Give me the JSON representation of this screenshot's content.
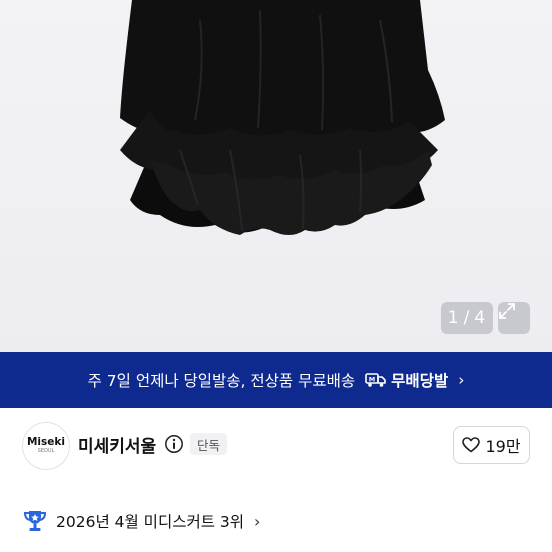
{
  "gallery": {
    "current": "1",
    "separator": "/",
    "total": "4"
  },
  "icons": {
    "expand": "expand-icon",
    "truck": "truck-icon",
    "info": "info-icon",
    "heart": "heart-icon",
    "trophy": "trophy-icon",
    "chevron": "chevron-right-icon"
  },
  "banner": {
    "text": "주 7일 언제나 당일발송, 전상품 무료배송",
    "badge": "무배당발",
    "chevron": "›",
    "color": "#0f2a8e"
  },
  "brand": {
    "logo_text": "Miseki",
    "logo_sub": "SEOUL",
    "name": "미세키서울",
    "tag": "단독",
    "likes": "19만"
  },
  "ranking": {
    "text": "2026년 4월 미디스커트 3위",
    "chevron": "›"
  }
}
